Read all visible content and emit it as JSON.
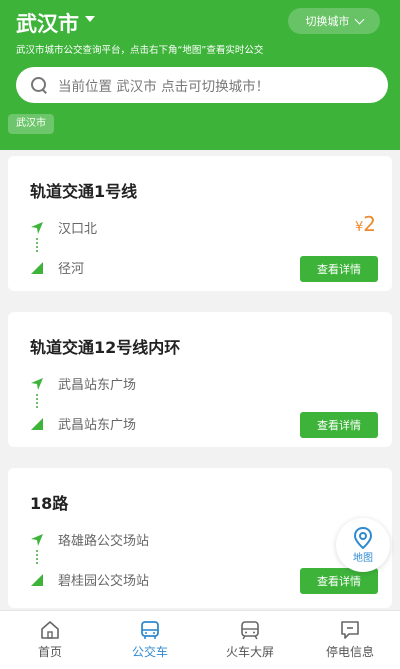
{
  "header": {
    "city": "武汉市",
    "switch_label": "切换城市",
    "subtitle": "武汉市城市公交查询平台，点击右下角“地图”查看实时公交",
    "search_placeholder": "当前位置 武汉市 点击可切换城市！",
    "city_tag": "武汉市"
  },
  "routes": [
    {
      "name": "轨道交通1号线",
      "from": "汉口北",
      "to": "径河",
      "price_symbol": "¥",
      "price": "2",
      "detail_label": "查看详情"
    },
    {
      "name": "轨道交通12号线内环",
      "from": "武昌站东广场",
      "to": "武昌站东广场",
      "detail_label": "查看详情"
    },
    {
      "name": "18路",
      "from": "珞雄路公交场站",
      "to": "碧桂园公交场站",
      "detail_label": "查看详情"
    }
  ],
  "map_button": {
    "label": "地图"
  },
  "nav": [
    {
      "label": "首页",
      "icon": "home-icon"
    },
    {
      "label": "公交车",
      "icon": "bus-icon"
    },
    {
      "label": "火车大屏",
      "icon": "train-icon"
    },
    {
      "label": "停电信息",
      "icon": "message-icon"
    }
  ],
  "colors": {
    "primary": "#3db33a",
    "price": "#ee8a2e",
    "active_nav": "#2f8ad0"
  }
}
